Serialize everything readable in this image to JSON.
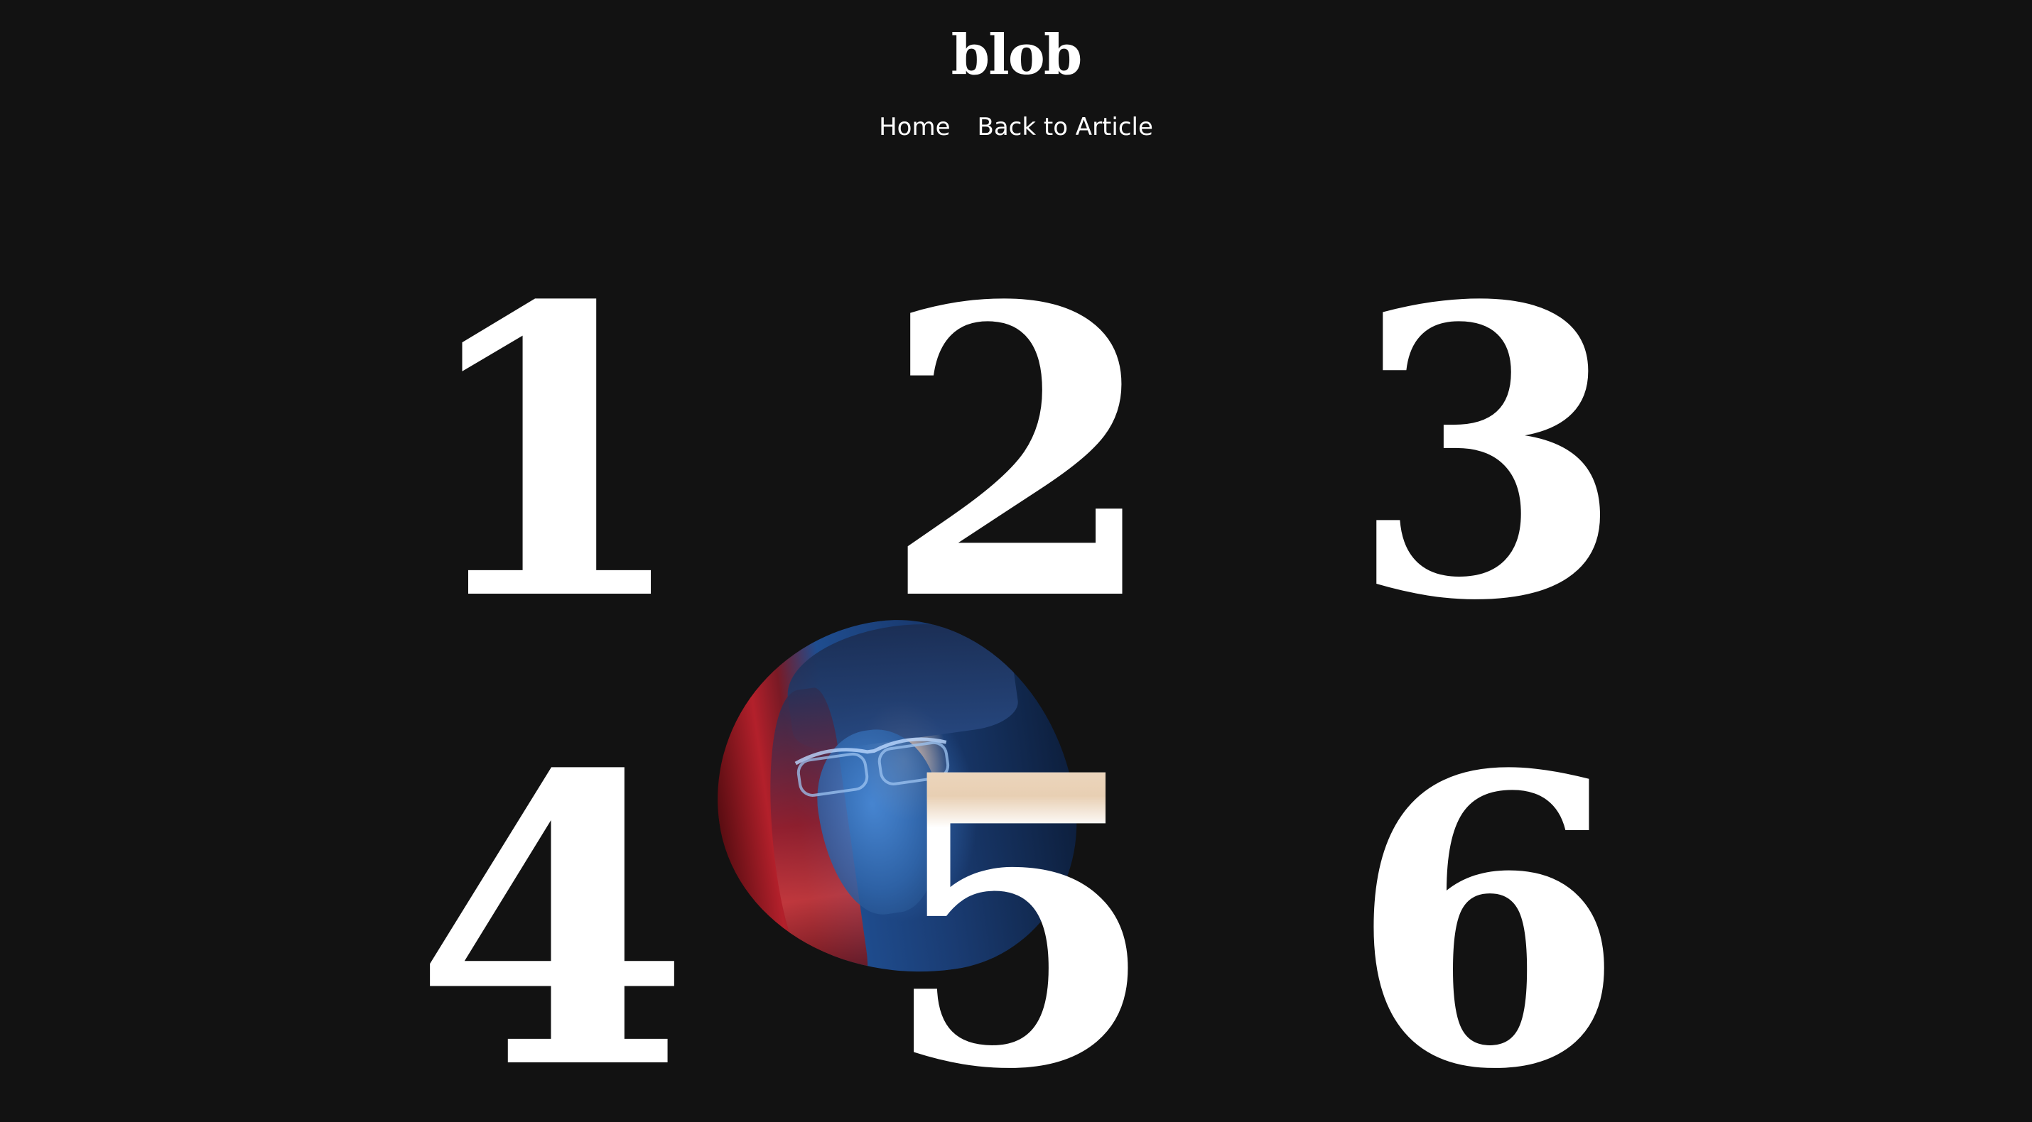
{
  "header": {
    "logo": "blob"
  },
  "nav": {
    "items": [
      {
        "label": "Home"
      },
      {
        "label": "Back to Article"
      }
    ]
  },
  "grid": {
    "numbers": [
      "1",
      "2",
      "3",
      "4",
      "5",
      "6"
    ]
  },
  "colors": {
    "background": "#121212",
    "text": "#ffffff"
  }
}
